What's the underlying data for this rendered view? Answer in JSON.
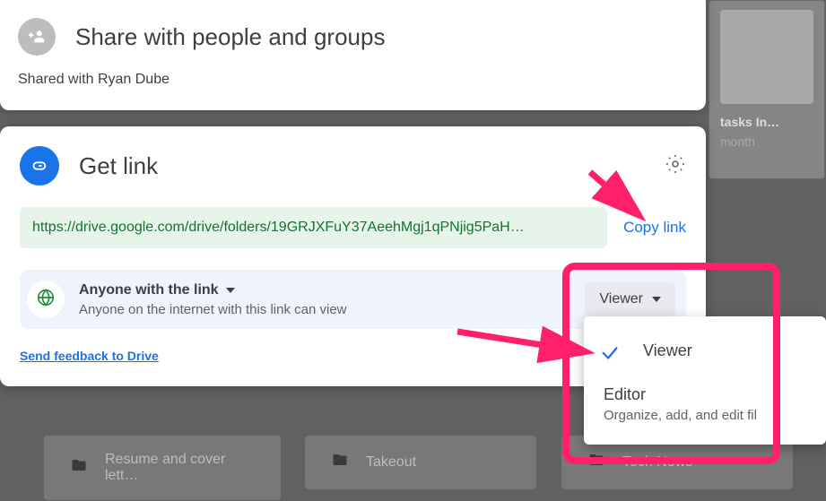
{
  "share_panel": {
    "title": "Share with people and groups",
    "subtitle": "Shared with Ryan Dube"
  },
  "link_panel": {
    "title": "Get link",
    "url": "https://drive.google.com/drive/folders/19GRJXFuY37AeehMgj1qPNjig5PaH…",
    "copy_label": "Copy link",
    "scope": {
      "title": "Anyone with the link",
      "subtitle": "Anyone on the internet with this link can view"
    },
    "role_button": "Viewer",
    "feedback": "Send feedback to Drive"
  },
  "role_menu": {
    "options": [
      {
        "label": "Viewer",
        "selected": true
      },
      {
        "label": "Editor",
        "desc": "Organize, add, and edit fil"
      }
    ]
  },
  "background": {
    "thumb_title": "tasks In…",
    "thumb_sub": "month",
    "folder1": "Resume and cover lett…",
    "folder2": "Takeout",
    "folder3": "Tech News"
  },
  "colors": {
    "primary": "#1a73e8",
    "green": "#1e8e3e",
    "highlight": "#ff1f6a"
  }
}
